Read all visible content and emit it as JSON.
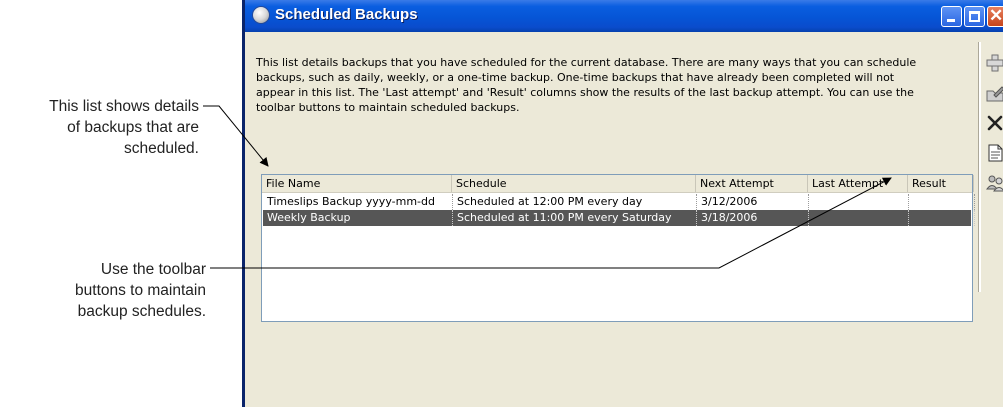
{
  "callouts": {
    "list_details": [
      "This list shows details",
      "of backups that are",
      "scheduled."
    ],
    "toolbar_buttons": [
      "Use the toolbar",
      "buttons to maintain",
      "backup schedules."
    ]
  },
  "window": {
    "title": "Scheduled Backups",
    "icon": "app-icon",
    "controls": [
      "minimize-icon",
      "maximize-icon",
      "close-icon"
    ]
  },
  "description": [
    "This list details backups that you have scheduled for the current database. There are many ways that you can schedule",
    "backups, such as daily, weekly, or a one-time backup. One-time backups that have already been completed will not",
    "appear in this list. The 'Last attempt' and 'Result' columns show the results of the last backup attempt. You can use the",
    "toolbar buttons to maintain scheduled backups."
  ],
  "backups_list": {
    "columns": [
      "File Name",
      "Schedule",
      "Next Attempt",
      "Last Attempt",
      "Result"
    ],
    "rows": [
      {
        "file_name": "Timeslips Backup yyyy-mm-dd",
        "schedule": "Scheduled at 12:00 PM every day",
        "next_attempt": "3/12/2006",
        "last_attempt": "",
        "result": "",
        "selected": false
      },
      {
        "file_name": "Weekly Backup",
        "schedule": "Scheduled at 11:00 PM every Saturday",
        "next_attempt": "3/18/2006",
        "last_attempt": "",
        "result": "",
        "selected": true
      }
    ]
  },
  "toolbar": {
    "buttons": [
      "add-icon",
      "edit-icon",
      "delete-icon",
      "details-icon",
      "users-icon"
    ]
  },
  "colors": {
    "titlebar": "#0655d6",
    "selection": "#565656",
    "window_face": "#ece9d8",
    "list_border": "#7f9db9"
  }
}
